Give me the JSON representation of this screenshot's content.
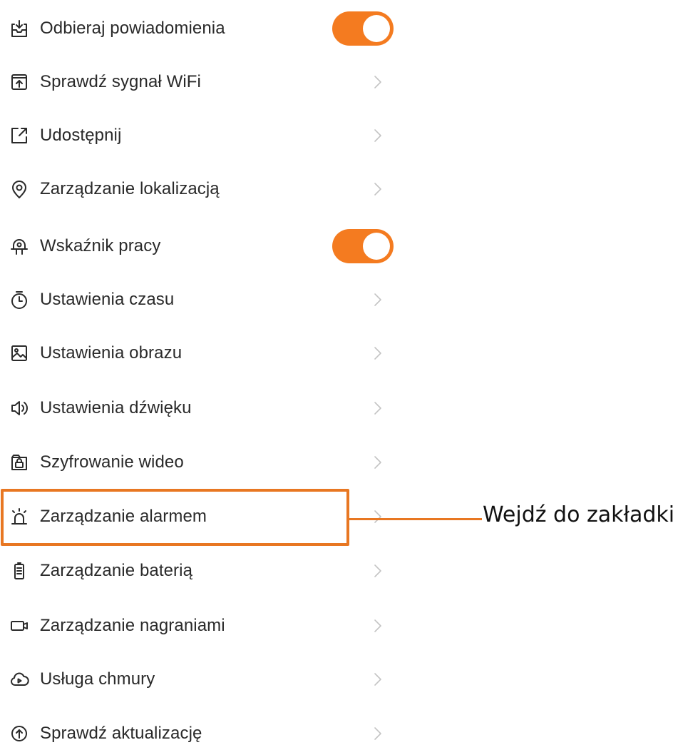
{
  "accent_color": "#f47b20",
  "callout_color": "#e87722",
  "settings": {
    "items": [
      {
        "label": "Odbieraj powiadomienia",
        "icon": "inbox-download-icon",
        "control": "toggle",
        "toggle_on": true
      },
      {
        "label": "Sprawdź sygnał WiFi",
        "icon": "signal-box-icon",
        "control": "chevron"
      },
      {
        "label": "Udostępnij",
        "icon": "share-external-icon",
        "control": "chevron"
      },
      {
        "label": "Zarządzanie lokalizacją",
        "icon": "location-pin-icon",
        "control": "chevron"
      },
      {
        "label": "Wskaźnik pracy",
        "icon": "indicator-light-icon",
        "control": "toggle",
        "toggle_on": true
      },
      {
        "label": "Ustawienia czasu",
        "icon": "timer-icon",
        "control": "chevron"
      },
      {
        "label": "Ustawienia obrazu",
        "icon": "image-icon",
        "control": "chevron"
      },
      {
        "label": "Ustawienia dźwięku",
        "icon": "speaker-icon",
        "control": "chevron"
      },
      {
        "label": "Szyfrowanie wideo",
        "icon": "lock-folder-icon",
        "control": "chevron"
      },
      {
        "label": "Zarządzanie alarmem",
        "icon": "alarm-siren-icon",
        "control": "chevron",
        "highlighted": true
      },
      {
        "label": "Zarządzanie baterią",
        "icon": "battery-icon",
        "control": "chevron"
      },
      {
        "label": "Zarządzanie nagraniami",
        "icon": "video-camera-icon",
        "control": "chevron"
      },
      {
        "label": "Usługa chmury",
        "icon": "cloud-play-icon",
        "control": "chevron"
      },
      {
        "label": "Sprawdź aktualizację",
        "icon": "update-arrow-icon",
        "control": "chevron"
      }
    ]
  },
  "annotation": {
    "text": "Wejdź do zakładki"
  }
}
